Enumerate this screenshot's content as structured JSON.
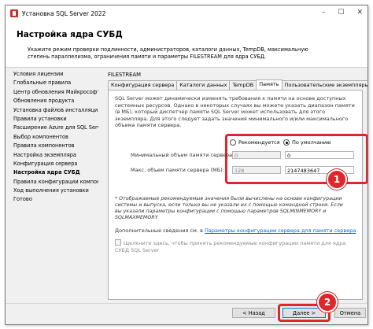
{
  "window": {
    "title": "Установка SQL Server 2022",
    "controls": [
      "–",
      "☐",
      "✕"
    ]
  },
  "header": {
    "title": "Настройка ядра СУБД",
    "description": "Укажите режим проверки подлинности, администраторов, каталоги данных, TempDB, максимальную степень параллелизма, ограничения памяти и параметры FILESTREAM для ядра СУБД."
  },
  "sidebar": {
    "items": [
      {
        "label": "Условия лицензии"
      },
      {
        "label": "Глобальные правила"
      },
      {
        "label": "Центр обновления Майкрософт"
      },
      {
        "label": "Обновления продукта"
      },
      {
        "label": "Установка файлов инсталляции"
      },
      {
        "label": "Правила установки"
      },
      {
        "label": "Расширение Azure для SQL Server"
      },
      {
        "label": "Выбор компонентов"
      },
      {
        "label": "Правила компонентов"
      },
      {
        "label": "Настройка экземпляра"
      },
      {
        "label": "Конфигурация сервера"
      },
      {
        "label": "Настройка ядра СУБД"
      },
      {
        "label": "Правила конфигурации компонентов"
      },
      {
        "label": "Ход выполнения установки"
      },
      {
        "label": "Готово"
      }
    ]
  },
  "main": {
    "filestream_label": "FILESTREAM",
    "tabs": [
      {
        "label": "Конфигурация сервера"
      },
      {
        "label": "Каталоги данных"
      },
      {
        "label": "TempDB"
      },
      {
        "label": "Память"
      },
      {
        "label": "Пользовательские экземпляры"
      }
    ],
    "intro_text": "SQL Server может динамически изменять требования к памяти на основе доступных системных ресурсов. Однако в некоторых случаях вы можете указать диапазон памяти (в МБ), который диспетчер памяти SQL Server может использовать для этого экземпляра. Для этого следует задать значения минимального и/или максимального объема памяти сервера.",
    "radio_recommended": "Рекомендуется",
    "radio_default": "По умолчанию",
    "min_label": "Минимальный объем памяти сервера (МБ):",
    "max_label": "Макс. объем памяти сервера (МБ):",
    "min_recommended": "0",
    "min_default": "0",
    "max_recommended": "128",
    "max_default": "2147483647",
    "note": "* Отображаемые рекомендуемые значения были вычислены на основе конфигурации системы и выпуска, если только вы не указали их с помощью командной строки. Если вы указали параметры конфигурации с помощью параметров SQLMINMEMORY и SQLMAXMEMORY",
    "link_prefix": "Дополнительные сведения см. в",
    "link_text": "Параметры конфигурации сервера для памяти сервера",
    "checkbox_label": "Щелкните здесь, чтобы принять рекомендуемые конфигурации памяти для ядра СУБД SQL Server"
  },
  "badges": {
    "one": "1",
    "two": "2"
  },
  "footer": {
    "back": "< Назад",
    "next": "Далее >",
    "cancel": "Отмена"
  },
  "colors": {
    "highlight": "#e0262a",
    "link": "#0066cc"
  }
}
